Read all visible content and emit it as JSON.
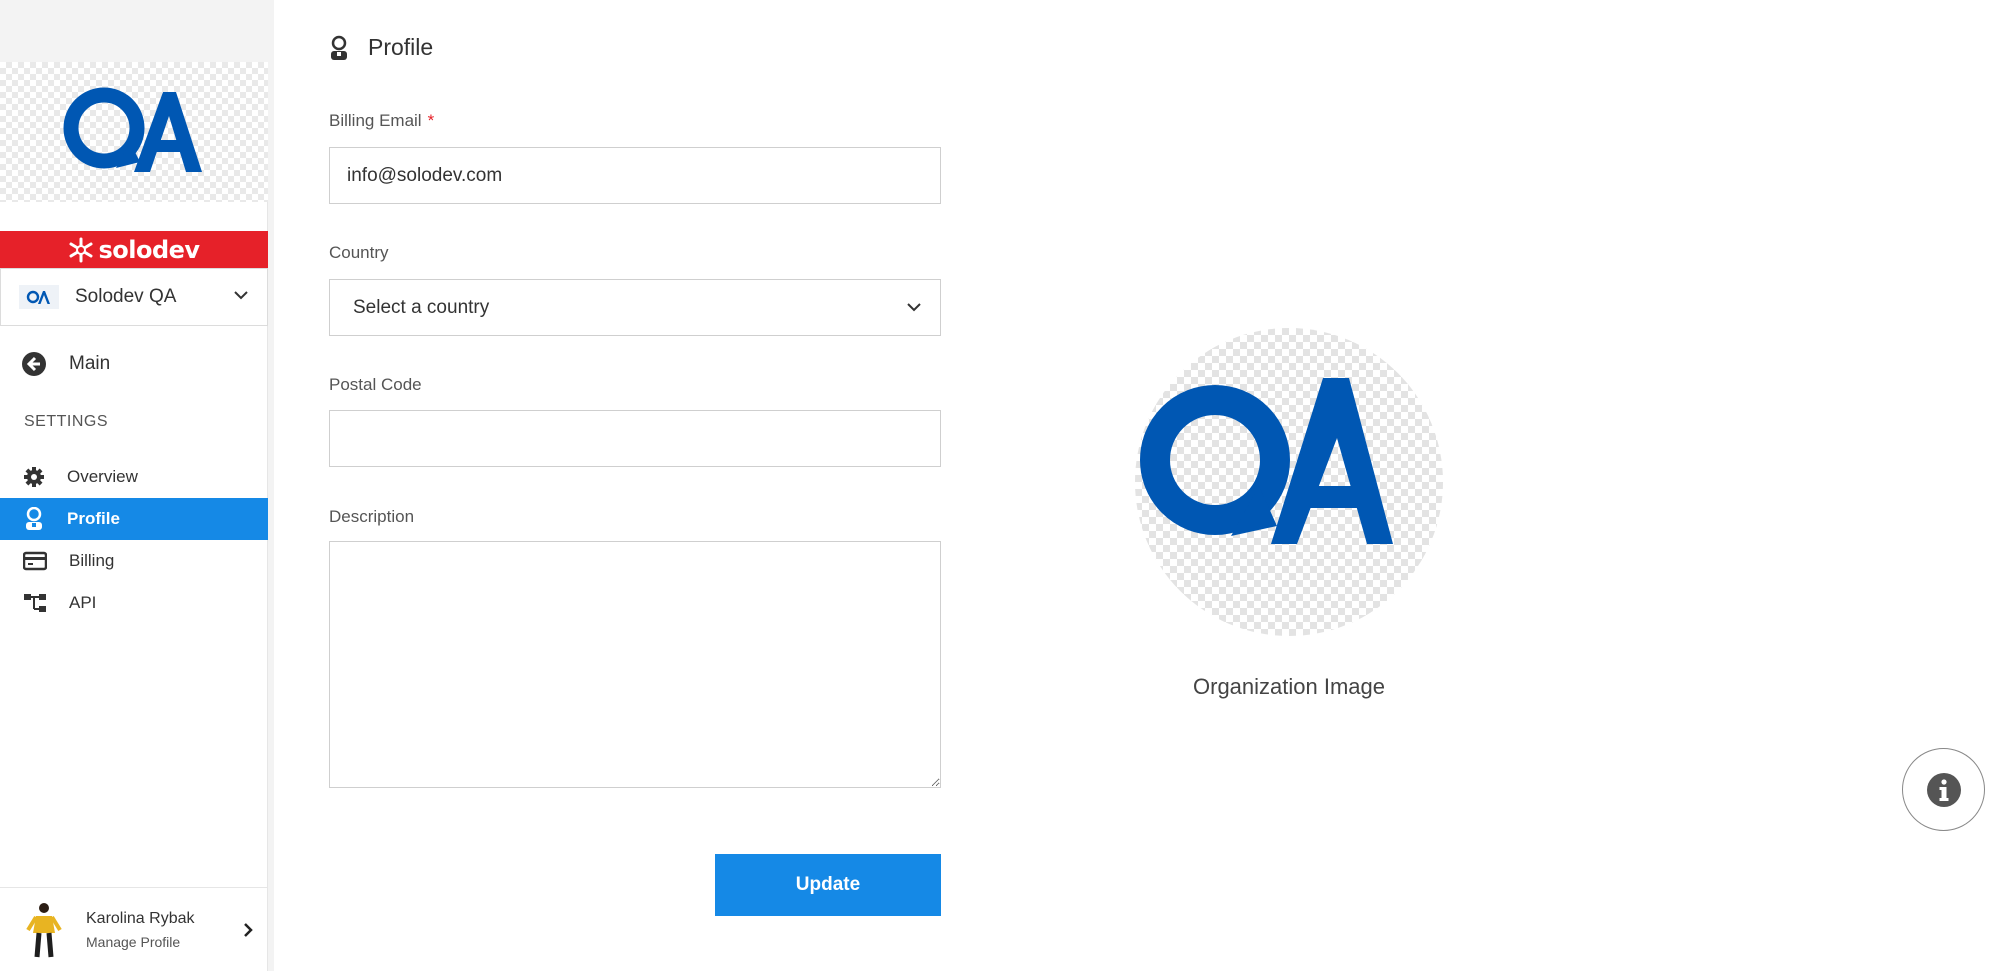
{
  "brand": {
    "name": "solodev",
    "color": "#e62129"
  },
  "org": {
    "logo_text": "QA",
    "selected": "Solodev QA",
    "logo_color": "#0057b3"
  },
  "sidebar": {
    "main_label": "Main",
    "settings_heading": "SETTINGS",
    "items": [
      {
        "label": "Overview",
        "icon": "gear-icon",
        "active": false
      },
      {
        "label": "Profile",
        "icon": "user-icon",
        "active": true
      },
      {
        "label": "Billing",
        "icon": "credit-card-icon",
        "active": false
      },
      {
        "label": "API",
        "icon": "sitemap-icon",
        "active": false
      }
    ],
    "active_color": "#1589e6"
  },
  "user": {
    "name": "Karolina Rybak",
    "subtitle": "Manage Profile"
  },
  "page": {
    "title": "Profile",
    "title_icon": "user-icon"
  },
  "form": {
    "billing_email": {
      "label": "Billing Email",
      "required": "*",
      "value": "info@solodev.com"
    },
    "country": {
      "label": "Country",
      "value": "Select a country"
    },
    "postal_code": {
      "label": "Postal Code",
      "value": ""
    },
    "description": {
      "label": "Description",
      "value": ""
    },
    "submit_label": "Update"
  },
  "organization_image": {
    "caption": "Organization Image"
  },
  "info_button": {
    "icon": "info-icon"
  }
}
